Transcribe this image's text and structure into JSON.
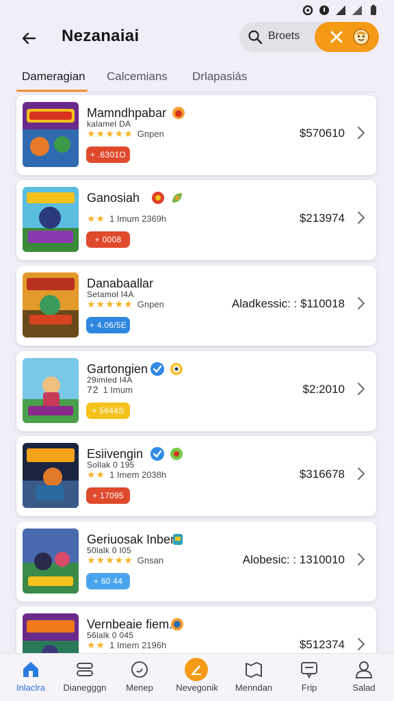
{
  "header": {
    "title": "Nezanaiai",
    "search_text": "Broets"
  },
  "tabs": [
    {
      "label": "Dameragian"
    },
    {
      "label": "Calcemians"
    },
    {
      "label": "Drlapasiás"
    }
  ],
  "games": [
    {
      "name": "Mamndhpabar",
      "sub": "kalamel DA",
      "stars": "★★★★★",
      "rating_text": "Gnpen",
      "pill": "+ .6301O",
      "pill_color": "#e04a2c",
      "price": "$570610"
    },
    {
      "name": "Ganosiah",
      "sub": "",
      "stars": "★★",
      "rating_text": "1 Imum   2369h",
      "pill": "+ 0008",
      "pill_color": "#e04a2c",
      "price": "$213974"
    },
    {
      "name": "Danabaallar",
      "sub": "Setamol I4A",
      "stars": "★★★★★",
      "rating_text": "Gnpen",
      "pill": "+ 4.06/5E",
      "pill_color": "#2d86e0",
      "price": "Aladkessic: : $110018"
    },
    {
      "name": "Gartongien",
      "sub": "29imled I4A",
      "stars": "72",
      "rating_text": "1 Imum",
      "pill": "+ 5644S",
      "pill_color": "#f4c21d",
      "price": "$2:2010"
    },
    {
      "name": "Esiivengin",
      "sub": "Sollak 0 195",
      "stars": "★★",
      "rating_text": "1 Imem   2038h",
      "pill": "+ 17095",
      "pill_color": "#e04a2c",
      "price": "$316678"
    },
    {
      "name": "Geriuosak Inber",
      "sub": "50lalk 0 I05",
      "stars": "★★★★★",
      "rating_text": "Gnsan",
      "pill": "+ 60 44",
      "pill_color": "#4aa4ec",
      "price": "Alobesic: : 1310010"
    },
    {
      "name": "Vernbeaie fiem.",
      "sub": "56lalk 0 045",
      "stars": "★★",
      "rating_text": "1 Imem   2196h",
      "pill": "",
      "pill_color": "#e04a2c",
      "price": "$512374"
    }
  ],
  "bottom_nav": [
    {
      "label": "Inlaclra"
    },
    {
      "label": "Dianegggn"
    },
    {
      "label": "Menep"
    },
    {
      "label": "Nevegonik"
    },
    {
      "label": "Menndan"
    },
    {
      "label": "Frip"
    },
    {
      "label": "Salad"
    }
  ],
  "colors": {
    "accent_orange": "#f59a16",
    "active_blue": "#2a6fd6",
    "star_yellow": "#f5b321"
  }
}
